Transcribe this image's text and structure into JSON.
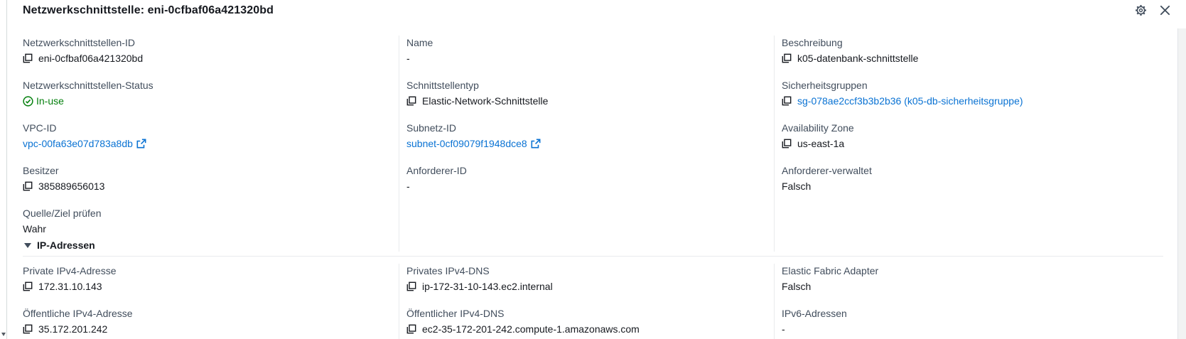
{
  "panel": {
    "title": "Netzwerkschnittstelle: eni-0cfbaf06a421320bd"
  },
  "details": {
    "eni_id": {
      "label": "Netzwerkschnittstellen-ID",
      "value": "eni-0cfbaf06a421320bd"
    },
    "name": {
      "label": "Name",
      "value": "-"
    },
    "description": {
      "label": "Beschreibung",
      "value": "k05-datenbank-schnittstelle"
    },
    "status": {
      "label": "Netzwerkschnittstellen-Status",
      "value": "In-use"
    },
    "interface_type": {
      "label": "Schnittstellentyp",
      "value": "Elastic-Network-Schnittstelle"
    },
    "security_groups": {
      "label": "Sicherheitsgruppen",
      "value": "sg-078ae2ccf3b3b2b36 (k05-db-sicherheitsgruppe)"
    },
    "vpc_id": {
      "label": "VPC-ID",
      "value": "vpc-00fa63e07d783a8db"
    },
    "subnet_id": {
      "label": "Subnetz-ID",
      "value": "subnet-0cf09079f1948dce8"
    },
    "availability_zone": {
      "label": "Availability Zone",
      "value": "us-east-1a"
    },
    "owner": {
      "label": "Besitzer",
      "value": "385889656013"
    },
    "requester_id": {
      "label": "Anforderer-ID",
      "value": "-"
    },
    "requester_managed": {
      "label": "Anforderer-verwaltet",
      "value": "Falsch"
    },
    "source_dest_check": {
      "label": "Quelle/Ziel prüfen",
      "value": "Wahr"
    }
  },
  "ip_section": {
    "title": "IP-Adressen",
    "private_ipv4": {
      "label": "Private IPv4-Adresse",
      "value": "172.31.10.143"
    },
    "private_ipv4_dns": {
      "label": "Privates IPv4-DNS",
      "value": "ip-172-31-10-143.ec2.internal"
    },
    "efa": {
      "label": "Elastic Fabric Adapter",
      "value": "Falsch"
    },
    "public_ipv4": {
      "label": "Öffentliche IPv4-Adresse",
      "value": "35.172.201.242"
    },
    "public_ipv4_dns": {
      "label": "Öffentlicher IPv4-DNS",
      "value": "ec2-35-172-201-242.compute-1.amazonaws.com"
    },
    "ipv6": {
      "label": "IPv6-Adressen",
      "value": "-"
    }
  },
  "colors": {
    "link": "#0972d3",
    "success": "#037f0c",
    "text": "#16191f",
    "label": "#414d5c"
  },
  "icons": {
    "settings": "gear-icon",
    "close": "close-icon",
    "copy": "copy-icon",
    "external": "external-link-icon",
    "status": "check-circle-icon",
    "expand": "caret-down-icon"
  }
}
